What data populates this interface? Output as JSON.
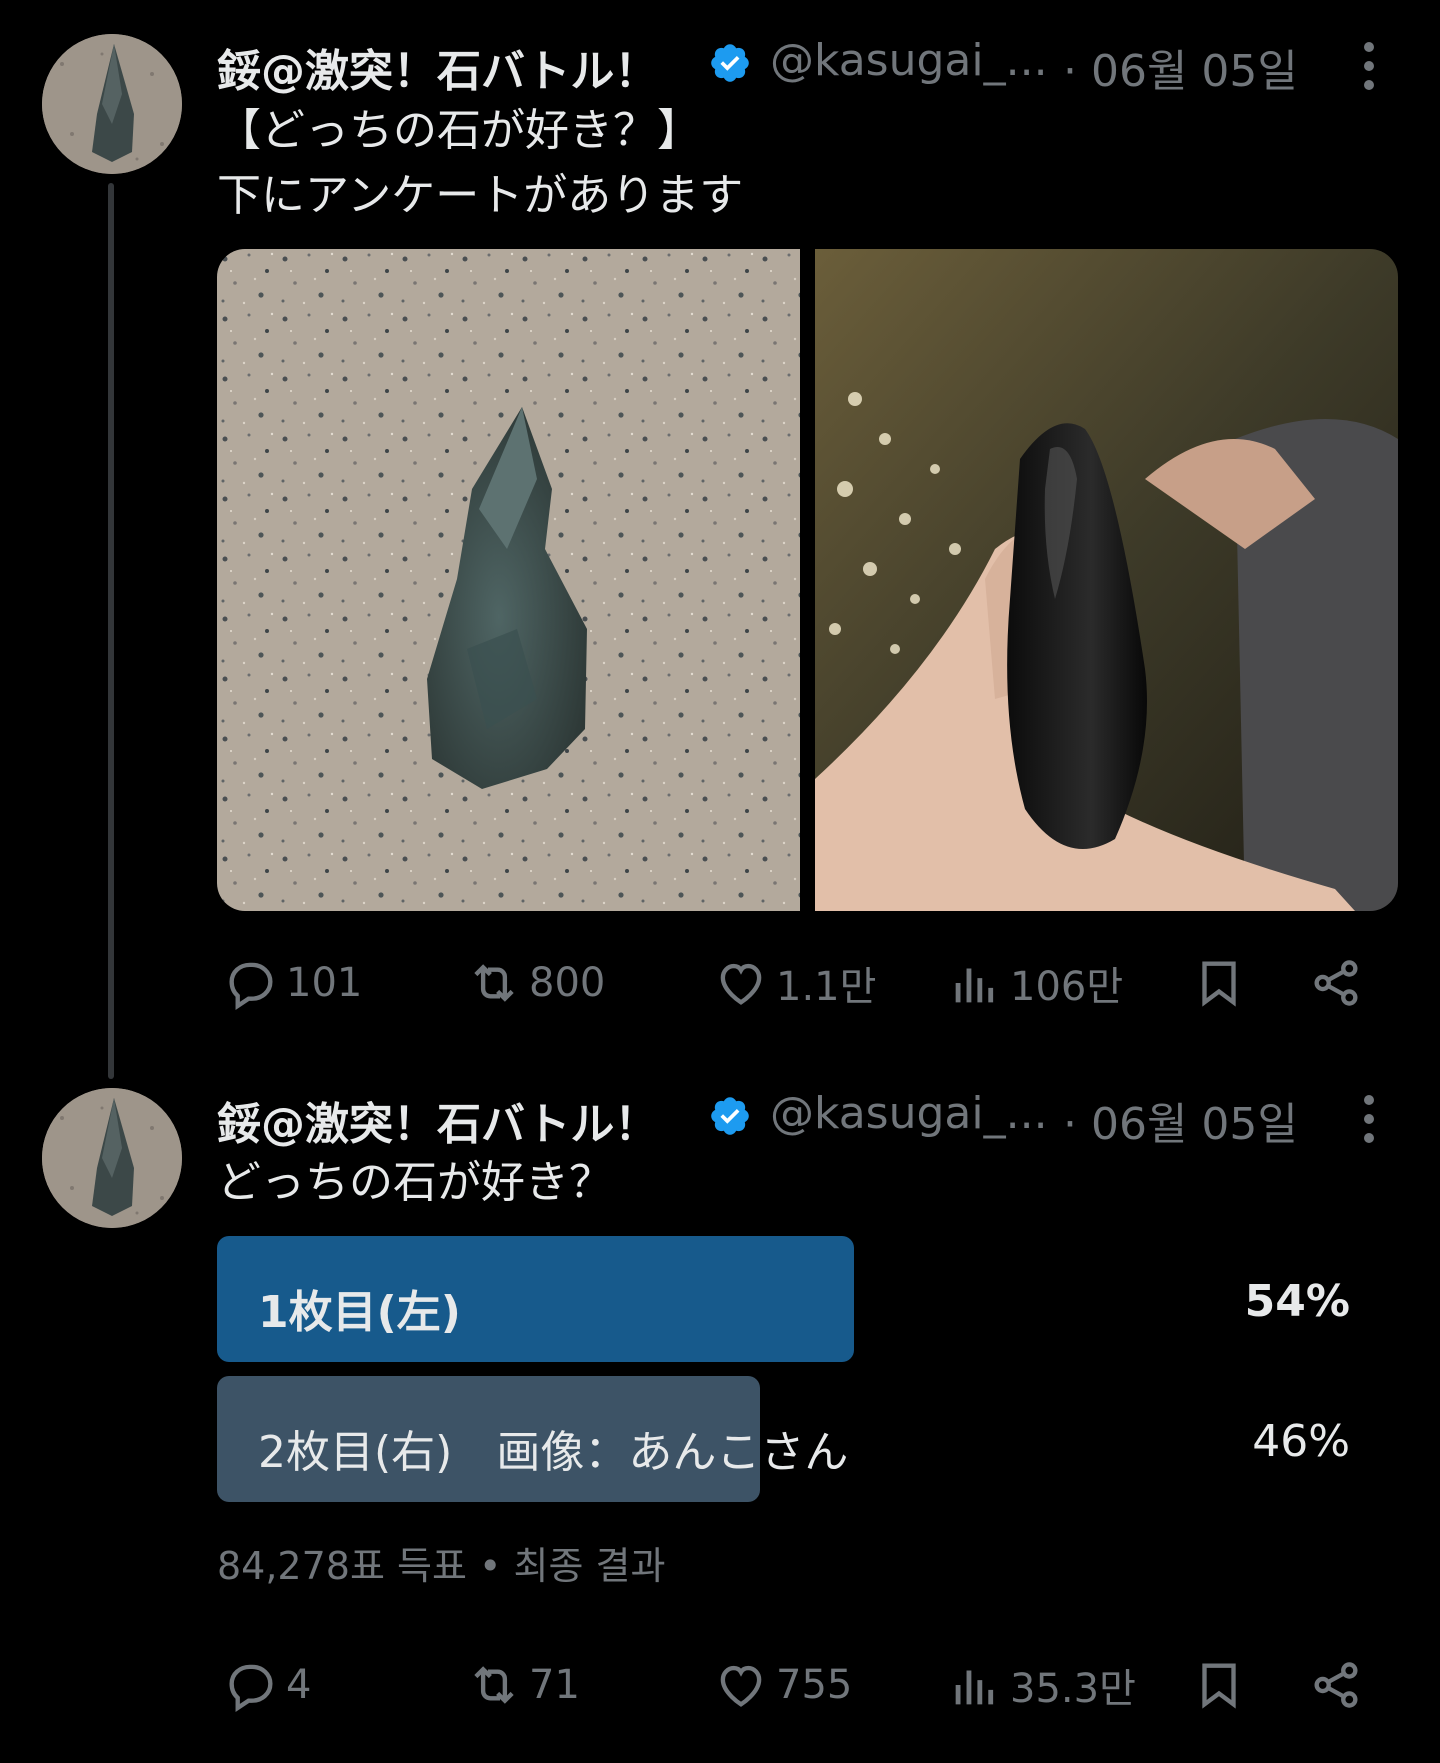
{
  "tweets": [
    {
      "author_name": "鋖@激突！石バトル！",
      "handle": "@kasugai_...",
      "date": "· 06월 05일",
      "text": "【どっちの石が好き？】\n下にアンケートがあります",
      "actions": {
        "replies": "101",
        "reposts": "800",
        "likes": "1.1만",
        "views": "106만"
      }
    },
    {
      "author_name": "鋖@激突！石バトル！",
      "handle": "@kasugai_...",
      "date": "· 06월 05일",
      "text": "どっちの石が好き？",
      "poll": {
        "options": [
          {
            "label": "1枚目(左)",
            "percent_text": "54%",
            "percent": 54,
            "winner": true
          },
          {
            "label": "2枚目(右)　画像：あんこさん",
            "percent_text": "46%",
            "percent": 46,
            "winner": false
          }
        ],
        "summary": "84,278표 득표 • 최종 결과"
      },
      "actions": {
        "replies": "4",
        "reposts": "71",
        "likes": "755",
        "views": "35.3만"
      }
    }
  ],
  "colors": {
    "verified": "#1d9bf0",
    "poll_winner": "#175a8c",
    "poll_other": "#3d5366",
    "muted": "#71767b"
  }
}
